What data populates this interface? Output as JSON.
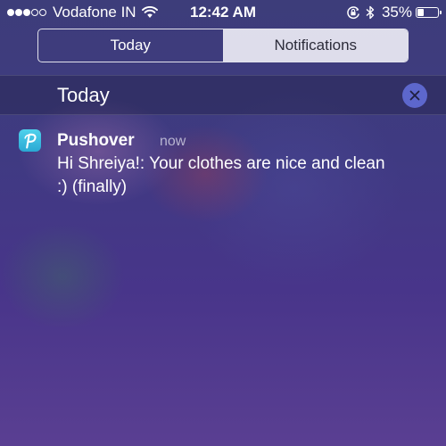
{
  "status_bar": {
    "signal_bars_filled": 3,
    "signal_bars_total": 5,
    "carrier": "Vodafone IN",
    "time": "12:42 AM",
    "battery_percent_label": "35%",
    "battery_level": 0.35,
    "icons": [
      "wifi-icon",
      "orientation-lock-icon",
      "bluetooth-icon",
      "battery-icon"
    ]
  },
  "tabs": {
    "today_label": "Today",
    "notifications_label": "Notifications",
    "selected": "Notifications"
  },
  "section": {
    "title": "Today",
    "clear_icon": "close-icon",
    "clear_color": "#5d67cc"
  },
  "notifications": [
    {
      "app": "Pushover",
      "time": "now",
      "message": "Hi Shreiya!: Your clothes are nice and clean :) (finally)",
      "icon": "pushover-app-icon",
      "icon_color": "#3bbfe2"
    }
  ]
}
